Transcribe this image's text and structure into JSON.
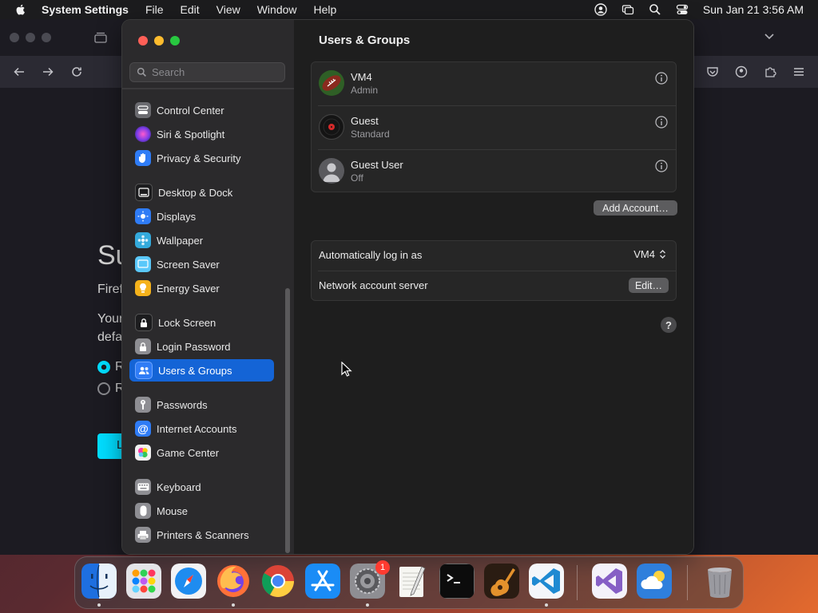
{
  "menubar": {
    "app_name": "System Settings",
    "items": [
      "File",
      "Edit",
      "View",
      "Window",
      "Help"
    ],
    "datetime": "Sun Jan 21  3:56 AM"
  },
  "background_window": {
    "heading": "Su",
    "line1": "Firef",
    "line2a": "Your",
    "line2b": "defa",
    "radio1": "R",
    "radio2": "R",
    "button": "L"
  },
  "sidebar": {
    "search_placeholder": "Search",
    "items": [
      {
        "label": "Control Center",
        "icon": "control-center-icon",
        "color": "#6b6b70"
      },
      {
        "label": "Siri & Spotlight",
        "icon": "siri-icon",
        "color": "#b04cd8"
      },
      {
        "label": "Privacy & Security",
        "icon": "hand-icon",
        "color": "#2f7cf6"
      },
      {
        "label": "Desktop & Dock",
        "icon": "dock-icon",
        "color": "#1c1c1e"
      },
      {
        "label": "Displays",
        "icon": "sun-icon",
        "color": "#2f7cf6"
      },
      {
        "label": "Wallpaper",
        "icon": "wallpaper-icon",
        "color": "#34aadc"
      },
      {
        "label": "Screen Saver",
        "icon": "screen-saver-icon",
        "color": "#5ac8fa"
      },
      {
        "label": "Energy Saver",
        "icon": "bulb-icon",
        "color": "#f5b21b"
      },
      {
        "label": "Lock Screen",
        "icon": "lock-icon",
        "color": "#1c1c1e"
      },
      {
        "label": "Login Password",
        "icon": "lock-icon",
        "color": "#8e8e93"
      },
      {
        "label": "Users & Groups",
        "icon": "users-icon",
        "color": "#2f7cf6"
      },
      {
        "label": "Passwords",
        "icon": "key-icon",
        "color": "#8e8e93"
      },
      {
        "label": "Internet Accounts",
        "icon": "at-icon",
        "color": "#2f7cf6"
      },
      {
        "label": "Game Center",
        "icon": "game-center-icon",
        "color": "#e8e8e8"
      },
      {
        "label": "Keyboard",
        "icon": "keyboard-icon",
        "color": "#8e8e93"
      },
      {
        "label": "Mouse",
        "icon": "mouse-icon",
        "color": "#8e8e93"
      },
      {
        "label": "Printers & Scanners",
        "icon": "printer-icon",
        "color": "#8e8e93"
      }
    ],
    "selected": "Users & Groups"
  },
  "main": {
    "title": "Users & Groups",
    "users": [
      {
        "name": "VM4",
        "role": "Admin"
      },
      {
        "name": "Guest",
        "role": "Standard"
      },
      {
        "name": "Guest User",
        "role": "Off"
      }
    ],
    "add_account_label": "Add Account…",
    "auto_login_label": "Automatically log in as",
    "auto_login_value": "VM4",
    "network_server_label": "Network account server",
    "edit_label": "Edit…",
    "help_label": "?"
  },
  "dock": {
    "apps": [
      "Finder",
      "Launchpad",
      "Safari",
      "Firefox",
      "Chrome",
      "App Store",
      "System Settings",
      "TextEdit",
      "Terminal",
      "GarageBand",
      "Visual Studio Code",
      "Visual Studio",
      "Weather",
      "Trash"
    ],
    "settings_badge": "1"
  }
}
